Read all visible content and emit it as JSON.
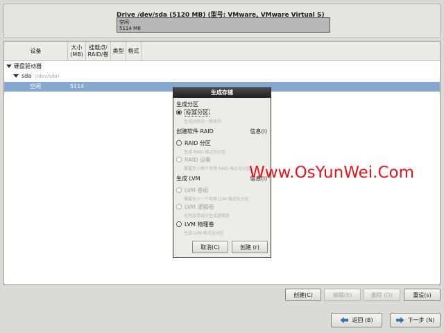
{
  "drive": {
    "title": "Drive /dev/sda (5120 MB) (型号: VMware, VMware Virtual S)",
    "bar_label": "空闲",
    "bar_size": "5114 MB"
  },
  "table": {
    "columns": [
      "设备",
      "大小\n(MB)",
      "挂载点/\nRAID/卷",
      "类型",
      "格式"
    ],
    "tree": {
      "group_label": "硬盘驱动器",
      "disk_label": "sda",
      "disk_path": "(/dev/sda)",
      "free_label": "空闲",
      "free_size": "5114"
    }
  },
  "dialog": {
    "title": "生成存储",
    "section_partition": "生成分区",
    "std_partition": "标准分区",
    "std_partition_desc": "生成分区的一般目的",
    "section_raid": "创建软件 RAID",
    "info1": "信息(I)",
    "raid_partition": "RAID 分区",
    "raid_partition_desc": "生成 RAID 格式化分区",
    "raid_device": "RAID 设备",
    "raid_device_desc": "需要至少两个可用 RAID 格式化分区",
    "section_lvm": "生成 LVM",
    "info2": "信息(I)",
    "lvm_vg": "LVM 卷组",
    "lvm_vg_desc": "需要至少一个可用 LVM 格式化分区",
    "lvm_lv": "LVM 逻辑卷",
    "lvm_lv_desc": "在所选卷组中生成逻辑卷",
    "lvm_pv": "LVM 物理卷",
    "lvm_pv_desc": "生成 LVM 格式化分区",
    "cancel": "取消(C)",
    "create": "创建 (r)"
  },
  "buttons": {
    "create": "创建(C)",
    "edit": "编辑(E)",
    "delete": "删除 (D)",
    "reset": "重设(s)",
    "back": "返回 (B)",
    "next": "下一步 (N)"
  },
  "watermark": "Www.OsYunWei.Com",
  "colors": {
    "selected_row": "#86a8cf",
    "watermark": "#e8141b",
    "background": "#dcdad5"
  }
}
